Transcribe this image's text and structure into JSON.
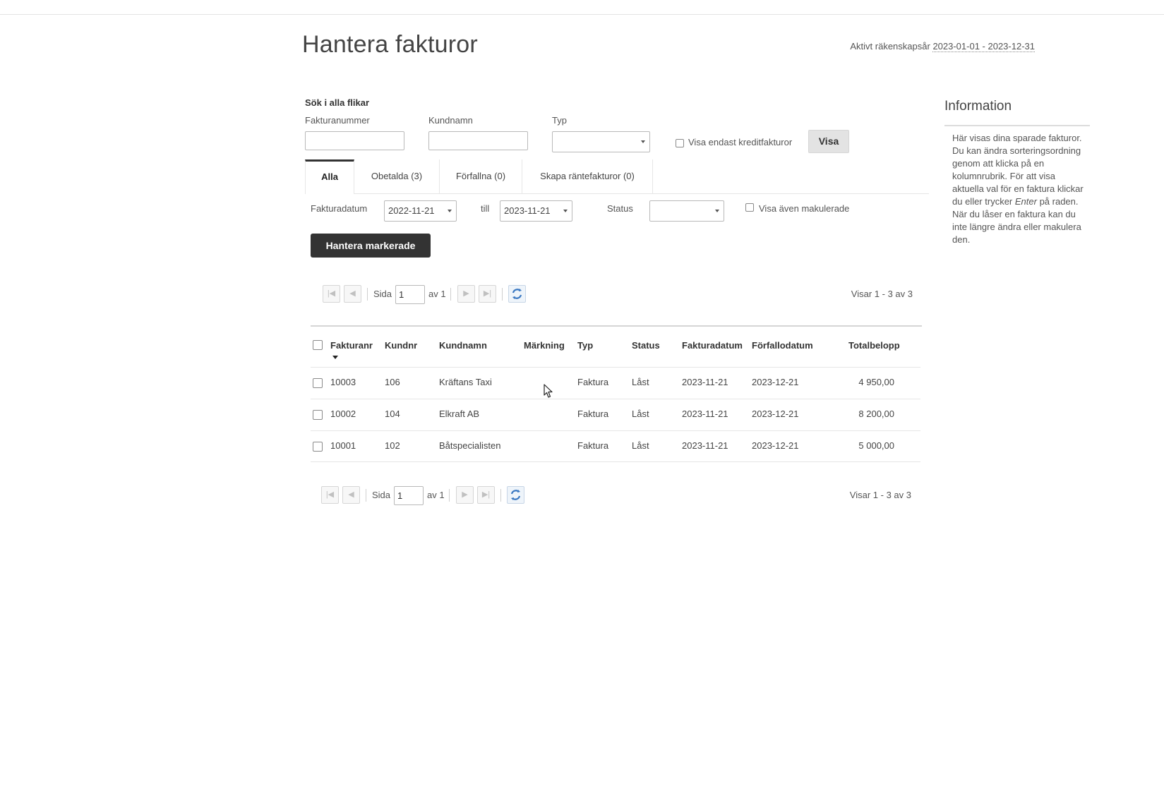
{
  "header": {
    "title": "Hantera fakturor",
    "fiscal_label": "Aktivt räkenskapsår",
    "fiscal_range": "2023-01-01 - 2023-12-31"
  },
  "search": {
    "heading": "Sök i alla flikar",
    "invoice_number_label": "Fakturanummer",
    "invoice_number_value": "",
    "customer_name_label": "Kundnamn",
    "customer_name_value": "",
    "type_label": "Typ",
    "type_value": "",
    "credit_only_label": "Visa endast kreditfakturor",
    "credit_only_checked": false,
    "show_button": "Visa"
  },
  "tabs": [
    {
      "label": "Alla",
      "active": true
    },
    {
      "label": "Obetalda (3)",
      "active": false
    },
    {
      "label": "Förfallna (0)",
      "active": false
    },
    {
      "label": "Skapa räntefakturor (0)",
      "active": false
    }
  ],
  "filters": {
    "date_label": "Fakturadatum",
    "date_from": "2022-11-21",
    "to_label": "till",
    "date_to": "2023-11-21",
    "status_label": "Status",
    "status_value": "",
    "show_voided_label": "Visa även makulerade",
    "show_voided_checked": false
  },
  "actions": {
    "manage_selected": "Hantera markerade"
  },
  "pager": {
    "page_label": "Sida",
    "page_value": "1",
    "of_label": "av 1",
    "summary": "Visar 1 - 3 av 3"
  },
  "table": {
    "columns": [
      "Fakturanr",
      "Kundnr",
      "Kundnamn",
      "Märkning",
      "Typ",
      "Status",
      "Fakturadatum",
      "Förfallodatum",
      "Totalbelopp"
    ],
    "sort_column": "Fakturanr",
    "sort_direction": "descending",
    "rows": [
      {
        "invoice": "10003",
        "customer_no": "106",
        "customer": "Kräftans Taxi",
        "marking": "",
        "type": "Faktura",
        "status": "Låst",
        "invoice_date": "2023-11-21",
        "due_date": "2023-12-21",
        "total": "4 950,00"
      },
      {
        "invoice": "10002",
        "customer_no": "104",
        "customer": "Elkraft AB",
        "marking": "",
        "type": "Faktura",
        "status": "Låst",
        "invoice_date": "2023-11-21",
        "due_date": "2023-12-21",
        "total": "8 200,00"
      },
      {
        "invoice": "10001",
        "customer_no": "102",
        "customer": "Båtspecialisten",
        "marking": "",
        "type": "Faktura",
        "status": "Låst",
        "invoice_date": "2023-11-21",
        "due_date": "2023-12-21",
        "total": "5 000,00"
      }
    ]
  },
  "sidebar": {
    "title": "Information",
    "text_part1": "Här visas dina sparade fakturor. Du kan ändra sorteringsordning genom att klicka på en kolumnrubrik. För att visa aktuella val för en faktura klickar du eller trycker ",
    "text_em": "Enter",
    "text_part2": " på raden. När du låser en faktura kan du inte längre ändra eller makulera den."
  },
  "colors": {
    "dark_button": "#333333",
    "light_button": "#e3e3e3",
    "divider": "#e6e6e6"
  }
}
